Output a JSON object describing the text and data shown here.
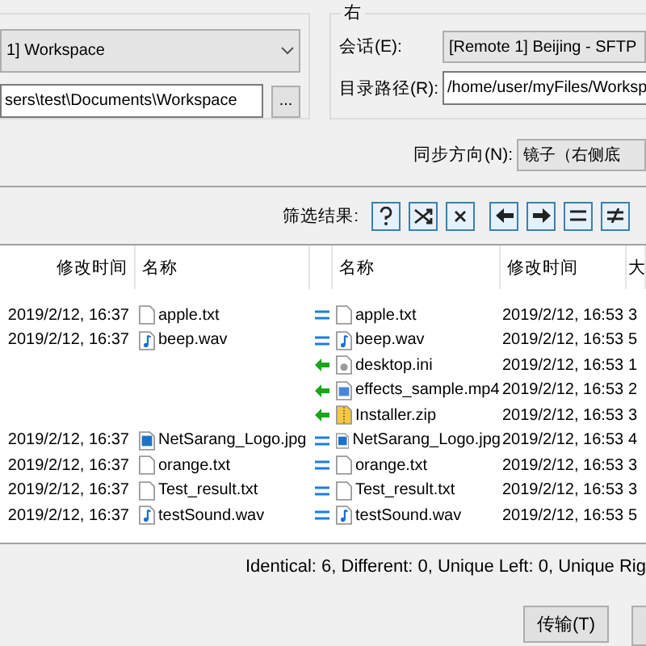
{
  "left": {
    "session": "1] Workspace",
    "path": "sers\\test\\Documents\\Workspace",
    "browse": "..."
  },
  "right": {
    "legend": "右",
    "session_label": "会话(E):",
    "session": "[Remote 1] Beijing - SFTP",
    "path_label": "目录路径(R):",
    "path": "/home/user/myFiles/Worksp"
  },
  "direction": {
    "label": "同步方向(N):",
    "value": "镜子（右侧底"
  },
  "filter": {
    "label": "筛选结果:",
    "buttons": [
      {
        "kind": "unknown"
      },
      {
        "kind": "different"
      },
      {
        "kind": "none"
      },
      {
        "kind": "left"
      },
      {
        "kind": "right"
      },
      {
        "kind": "identical"
      },
      {
        "kind": "changed"
      }
    ]
  },
  "table": {
    "columns": {
      "left_time": "修改时间",
      "left_name": "名称",
      "right_name": "名称",
      "right_time": "修改时间",
      "right_col_6": "大"
    },
    "rows": [
      {
        "left": {
          "time": "2019/2/12, 16:37",
          "name": "apple.txt",
          "kind": "text"
        },
        "kind": "identical",
        "right": {
          "name": "apple.txt",
          "kind": "text",
          "time": "2019/2/12, 16:53",
          "col_6": "3"
        }
      },
      {
        "left": {
          "time": "2019/2/12, 16:37",
          "name": "beep.wav",
          "kind": "audio"
        },
        "kind": "identical",
        "right": {
          "name": "beep.wav",
          "kind": "audio",
          "time": "2019/2/12, 16:53",
          "col_6": "5"
        }
      },
      {
        "left": null,
        "kind": "copy_left",
        "right": {
          "name": "desktop.ini",
          "kind": "settings",
          "time": "2019/2/12, 16:53",
          "col_6": "1"
        }
      },
      {
        "left": null,
        "kind": "copy_left",
        "right": {
          "name": "effects_sample.mp4",
          "kind": "video",
          "time": "2019/2/12, 16:53",
          "col_6": "2"
        }
      },
      {
        "left": null,
        "kind": "copy_left",
        "right": {
          "name": "Installer.zip",
          "kind": "archive",
          "time": "2019/2/12, 16:53",
          "col_6": "3"
        }
      },
      {
        "left": {
          "time": "2019/2/12, 16:37",
          "name": "NetSarang_Logo.jpg",
          "kind": "image"
        },
        "kind": "identical",
        "right": {
          "name": "NetSarang_Logo.jpg",
          "kind": "image",
          "time": "2019/2/12, 16:53",
          "col_6": "4"
        }
      },
      {
        "left": {
          "time": "2019/2/12, 16:37",
          "name": "orange.txt",
          "kind": "text"
        },
        "kind": "identical",
        "right": {
          "name": "orange.txt",
          "kind": "text",
          "time": "2019/2/12, 16:53",
          "col_6": "3"
        }
      },
      {
        "left": {
          "time": "2019/2/12, 16:37",
          "name": "Test_result.txt",
          "kind": "text"
        },
        "kind": "identical",
        "right": {
          "name": "Test_result.txt",
          "kind": "text",
          "time": "2019/2/12, 16:53",
          "col_6": "3"
        }
      },
      {
        "left": {
          "time": "2019/2/12, 16:37",
          "name": "testSound.wav",
          "kind": "audio"
        },
        "kind": "identical",
        "right": {
          "name": "testSound.wav",
          "kind": "audio",
          "time": "2019/2/12, 16:53",
          "col_6": "5"
        }
      }
    ]
  },
  "summary": "Identical: 6, Different: 0, Unique Left: 0, Unique Rig",
  "buttons": [
    {
      "label": "传输(T)"
    }
  ]
}
